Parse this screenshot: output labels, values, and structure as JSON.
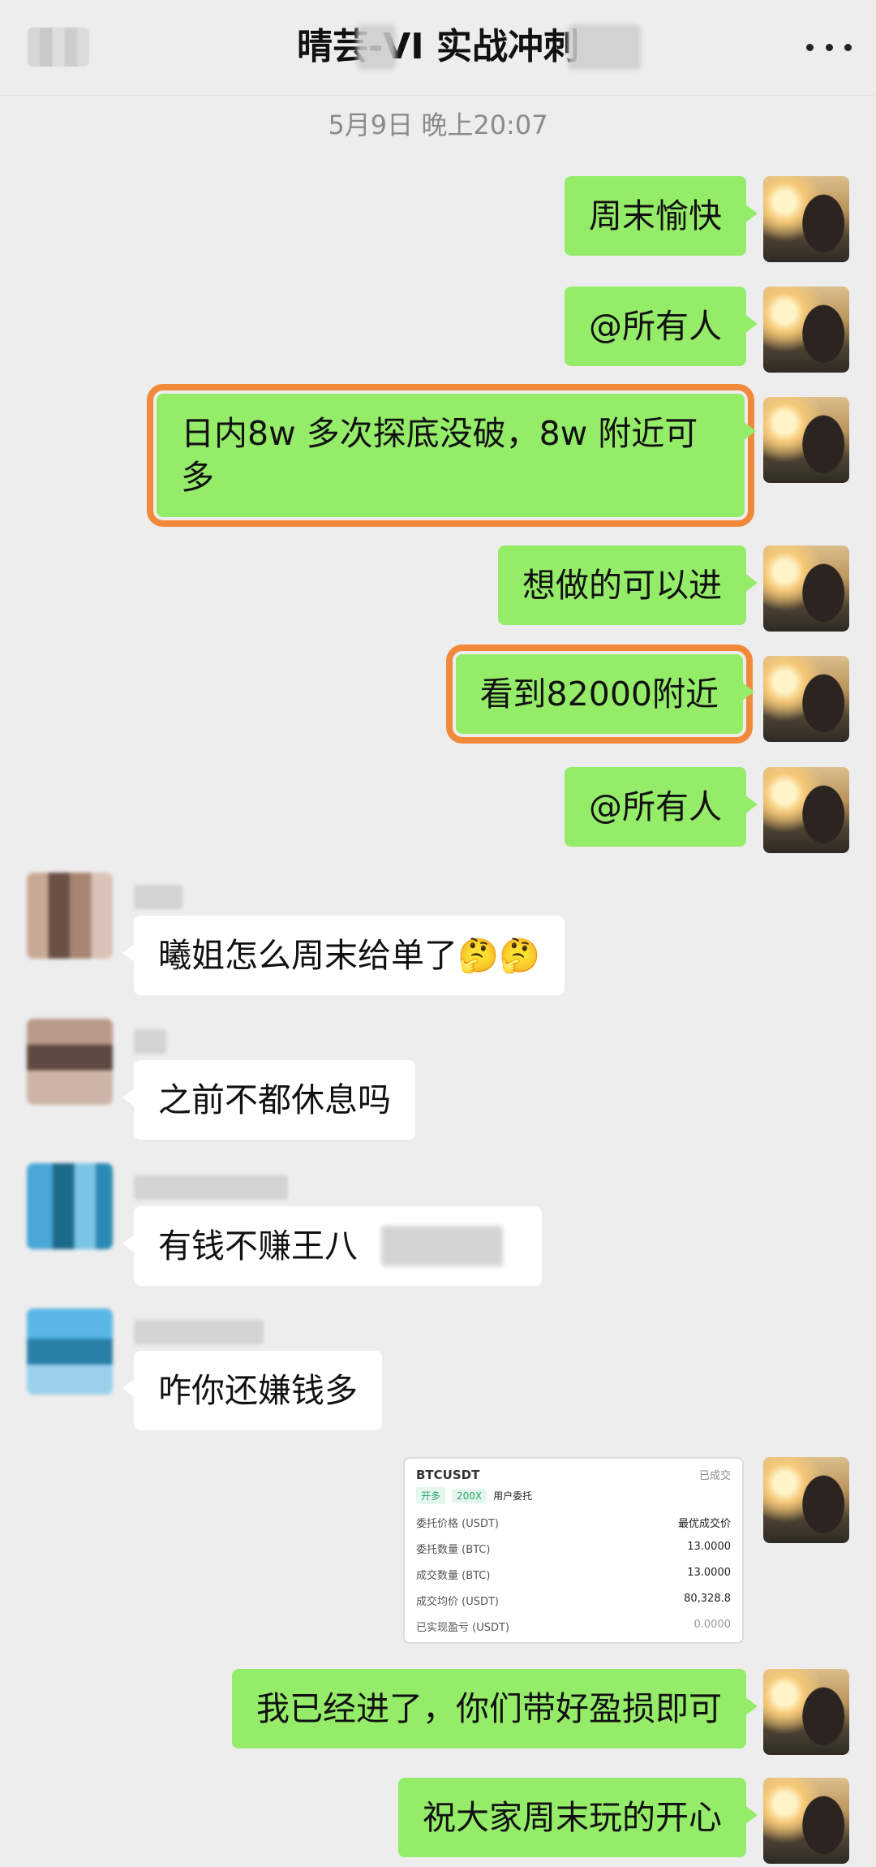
{
  "header": {
    "title": "晴芸-VI 实战冲刺",
    "more_icon": "ellipsis-icon"
  },
  "timestamp": "5月9日 晚上20:07",
  "messages_right": [
    "周末愉快",
    "@所有人",
    "日内8w 多次探底没破，8w 附近可多",
    "想做的可以进",
    "看到82000附近",
    "@所有人",
    "我已经进了，你们带好盈损即可",
    "祝大家周末玩的开心"
  ],
  "messages_left": [
    "曦姐怎么周末给单了🤔🤔",
    "之前不都休息吗",
    "有钱不赚王八",
    "咋你还嫌钱多"
  ],
  "trade_card": {
    "symbol": "BTCUSDT",
    "status": "已成交",
    "tag_side": "开多",
    "tag_leverage": "200X",
    "tag_type": "用户委托",
    "rows": [
      {
        "label": "委托价格 (USDT)",
        "value": "最优成交价"
      },
      {
        "label": "委托数量 (BTC)",
        "value": "13.0000"
      },
      {
        "label": "成交数量 (BTC)",
        "value": "13.0000"
      },
      {
        "label": "成交均价 (USDT)",
        "value": "80,328.8"
      },
      {
        "label": "已实现盈亏 (USDT)",
        "value": "0.0000"
      }
    ]
  },
  "colors": {
    "bubble_right": "#95ec69",
    "highlight": "#f08a3a",
    "background": "#ededed"
  }
}
